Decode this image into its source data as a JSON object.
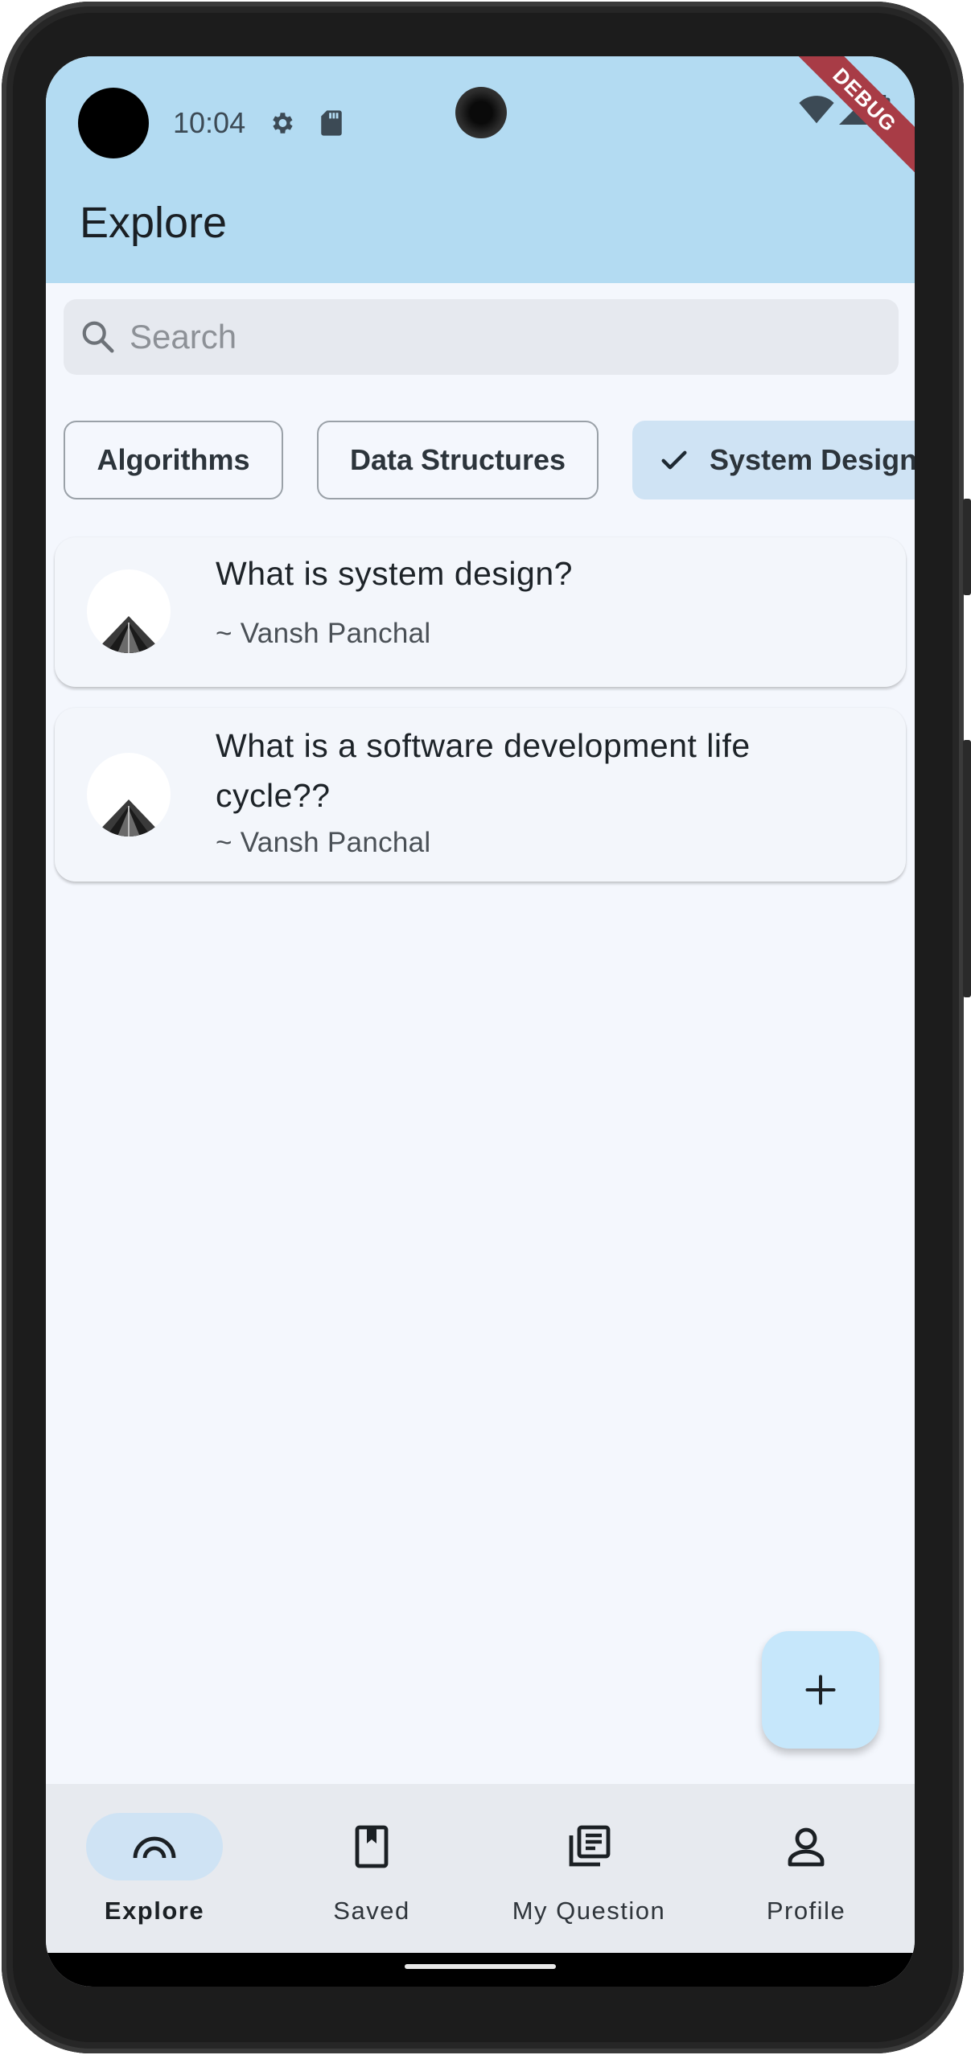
{
  "status_bar": {
    "time": "10:04",
    "debug_label": "DEBUG"
  },
  "app_bar": {
    "title": "Explore"
  },
  "search": {
    "placeholder": "Search"
  },
  "chips": [
    {
      "label": "Algorithms",
      "selected": false
    },
    {
      "label": "Data Structures",
      "selected": false
    },
    {
      "label": "System Design",
      "selected": true
    }
  ],
  "questions": [
    {
      "title": "What is system design?",
      "author": "~ Vansh Panchal"
    },
    {
      "title": "What is a software development life cycle??",
      "author": "~ Vansh Panchal"
    }
  ],
  "fab": {
    "icon": "plus-icon"
  },
  "bottom_nav": {
    "items": [
      {
        "label": "Explore",
        "icon": "explore-arc-icon",
        "active": true
      },
      {
        "label": "Saved",
        "icon": "bookmark-icon",
        "active": false
      },
      {
        "label": "My Question",
        "icon": "library-books-icon",
        "active": false
      },
      {
        "label": "Profile",
        "icon": "person-icon",
        "active": false
      }
    ]
  },
  "colors": {
    "app_bar": "#b3dbf2",
    "background": "#f4f7fd",
    "selected_chip": "#cfe3f4",
    "fab": "#c6e7fb",
    "debug_ribbon": "#a83c46"
  }
}
